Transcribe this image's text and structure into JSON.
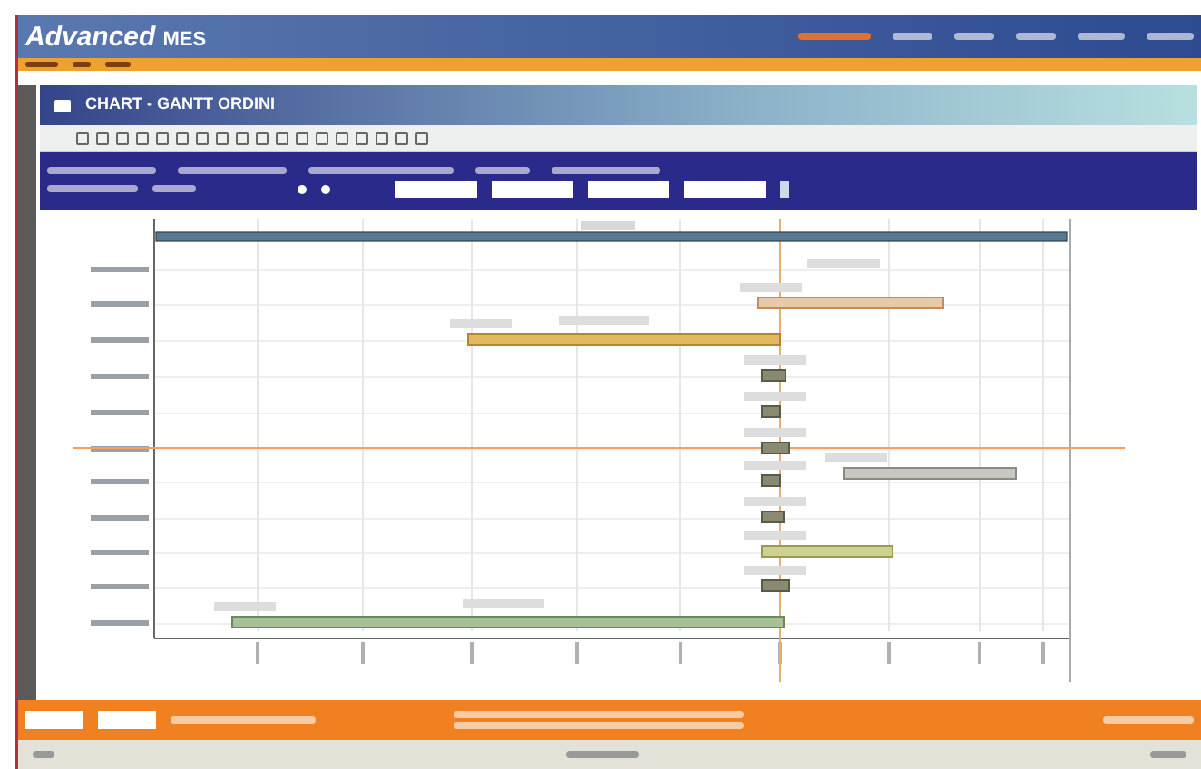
{
  "header": {
    "logo": "Advanced",
    "logo_sub": "MES"
  },
  "panel": {
    "title": "CHART - GANTT ORDINI"
  }
}
